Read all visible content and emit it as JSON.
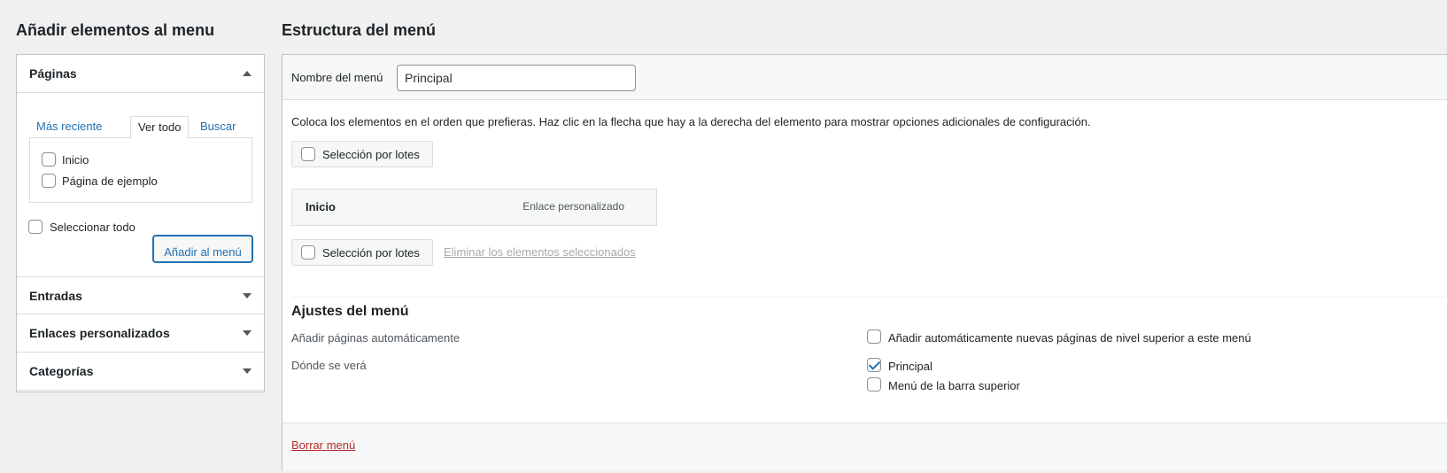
{
  "left": {
    "title": "Añadir elementos al menu",
    "sections": {
      "pages": {
        "label": "Páginas",
        "expanded": true
      },
      "posts": {
        "label": "Entradas"
      },
      "custom_links": {
        "label": "Enlaces personalizados"
      },
      "categories": {
        "label": "Categorías"
      }
    },
    "tabs": {
      "recent": "Más reciente",
      "all": "Ver todo",
      "search": "Buscar"
    },
    "pages_list": [
      {
        "label": "Inicio",
        "checked": false
      },
      {
        "label": "Página de ejemplo",
        "checked": false
      }
    ],
    "select_all": "Seleccionar todo",
    "add_button": "Añadir al menú"
  },
  "right": {
    "title": "Estructura del menú",
    "menu_name_label": "Nombre del menú",
    "menu_name_value": "Principal",
    "instructions": "Coloca los elementos en el orden que prefieras. Haz clic en la flecha que hay a la derecha del elemento para mostrar opciones adicionales de configuración.",
    "bulk_select": "Selección por lotes",
    "menu_items": [
      {
        "title": "Inicio",
        "type": "Enlace personalizado"
      }
    ],
    "remove_selected": "Eliminar los elementos seleccionados",
    "settings": {
      "title": "Ajustes del menú",
      "auto_add_label": "Añadir páginas automáticamente",
      "auto_add_option": "Añadir automáticamente nuevas páginas de nivel superior a este menú",
      "auto_add_checked": false,
      "location_label": "Dónde se verá",
      "locations": [
        {
          "label": "Principal",
          "checked": true
        },
        {
          "label": "Menú de la barra superior",
          "checked": false
        }
      ]
    },
    "delete_menu": "Borrar menú"
  },
  "colors": {
    "link": "#2271b1",
    "danger": "#b32d2e",
    "background": "#f0f0f1",
    "border": "#c3c4c7"
  }
}
